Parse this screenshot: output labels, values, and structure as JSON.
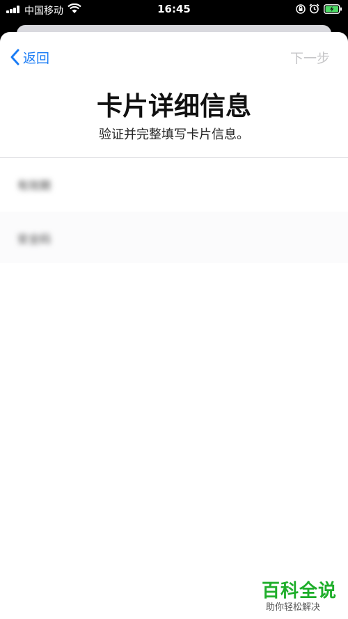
{
  "status_bar": {
    "carrier": "中国移动",
    "time": "16:45"
  },
  "nav": {
    "back_label": "返回",
    "next_label": "下一步"
  },
  "page": {
    "title": "卡片详细信息",
    "subtitle": "验证并完整填写卡片信息。"
  },
  "fields": [
    {
      "label": "有效期"
    },
    {
      "label": "安全码"
    }
  ],
  "watermark": {
    "title": "百科全说",
    "subtitle": "助你轻松解决"
  },
  "colors": {
    "accent": "#1a7cf5",
    "disabled": "#c6c6c8",
    "battery_charge": "#4cd964",
    "watermark": "#1fae2b"
  }
}
